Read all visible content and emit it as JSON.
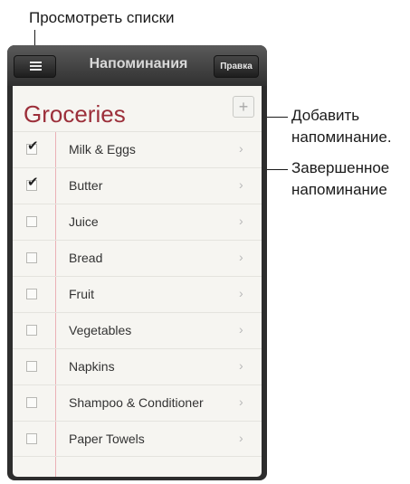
{
  "callouts": {
    "view_lists": "Просмотреть списки",
    "add_reminder": "Добавить напоминание.",
    "completed_reminder": "Завершенное напоминание"
  },
  "navbar": {
    "title": "Напоминания",
    "edit_label": "Правка",
    "menu_icon": "hamburger-icon"
  },
  "list": {
    "title": "Groceries",
    "add_label": "+",
    "items": [
      {
        "label": "Milk & Eggs",
        "checked": true
      },
      {
        "label": "Butter",
        "checked": true
      },
      {
        "label": "Juice",
        "checked": false
      },
      {
        "label": "Bread",
        "checked": false
      },
      {
        "label": "Fruit",
        "checked": false
      },
      {
        "label": "Vegetables",
        "checked": false
      },
      {
        "label": "Napkins",
        "checked": false
      },
      {
        "label": "Shampoo & Conditioner",
        "checked": false
      },
      {
        "label": "Paper Towels",
        "checked": false
      }
    ],
    "chevron": "›",
    "check_glyph": "✔"
  },
  "colors": {
    "list_title": "#9c2f3a",
    "margin_line": "#eab1b6",
    "navbar": "#303030"
  }
}
